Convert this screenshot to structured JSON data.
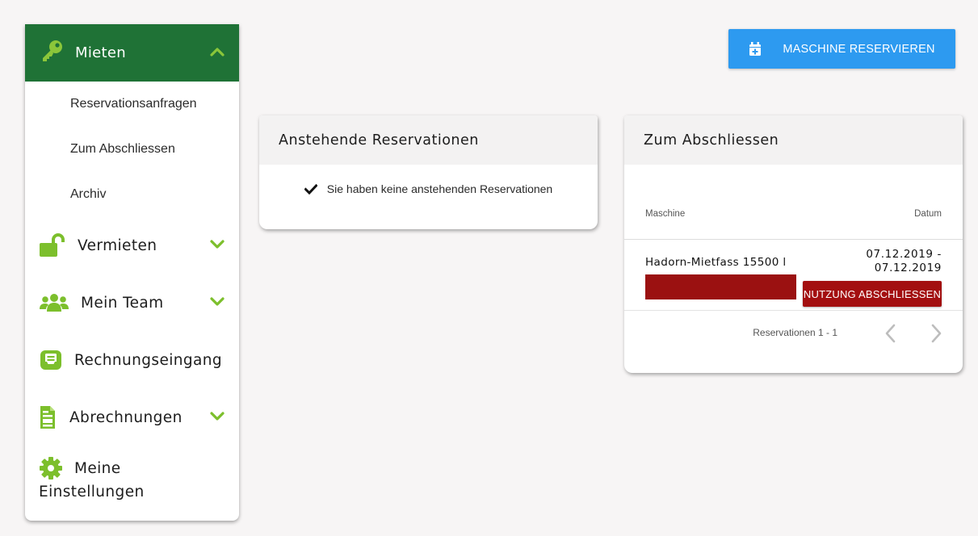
{
  "sidebar": {
    "active": {
      "label": "Mieten",
      "icon": "key-icon",
      "chevron": "chevron-up-icon"
    },
    "sub_items": [
      {
        "label": "Reservationsanfragen"
      },
      {
        "label": "Zum Abschliessen"
      },
      {
        "label": "Archiv"
      }
    ],
    "items": [
      {
        "label": "Vermieten",
        "icon": "unlock-icon",
        "has_chevron": true
      },
      {
        "label": "Mein Team",
        "icon": "team-icon",
        "has_chevron": true
      },
      {
        "label": "Rechnungseingang",
        "icon": "invoice-inbox-icon",
        "has_chevron": false
      },
      {
        "label": "Abrechnungen",
        "icon": "document-icon",
        "has_chevron": true
      },
      {
        "label": "Meine Einstellungen",
        "label_line1": "Meine",
        "label_line2": "Einstellungen",
        "icon": "gear-icon",
        "has_chevron": false
      }
    ]
  },
  "header": {
    "reserve_button": {
      "label": "MASCHINE RESERVIEREN",
      "icon": "calendar-plus-icon"
    }
  },
  "pending": {
    "title": "Anstehende Reservationen",
    "empty_message": "Sie haben keine anstehenden Reservationen",
    "icon": "checkmark-icon"
  },
  "to_close": {
    "title": "Zum Abschliessen",
    "columns": {
      "machine": "Maschine",
      "date": "Datum"
    },
    "rows": [
      {
        "machine": "Hadorn-Mietfass 15500 l",
        "date_line1": "07.12.2019 -",
        "date_line2": "07.12.2019",
        "action": "NUTZUNG ABSCHLIESSEN"
      }
    ],
    "pagination": {
      "text": "Reservationen 1 - 1"
    }
  },
  "colors": {
    "sidebar_active": "#1f7236",
    "icon_green": "#7cbf2c",
    "primary": "#2d9af0",
    "danger": "#a30f10"
  }
}
